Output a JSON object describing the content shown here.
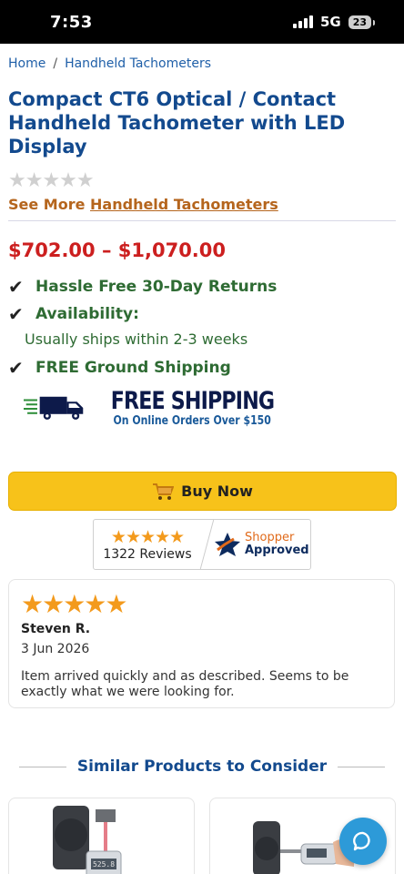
{
  "status_bar": {
    "time": "7:53",
    "network": "5G",
    "battery": "23"
  },
  "breadcrumb": {
    "home": "Home",
    "separator": "/",
    "category": "Handheld Tachometers"
  },
  "product": {
    "title": "Compact CT6 Optical / Contact Handheld Tachometer with LED Display",
    "rating_stars_empty": "★★★★★",
    "see_more_prefix": "See More",
    "see_more_link": "Handheld Tachometers",
    "price": "$702.00 – $1,070.00"
  },
  "features": {
    "check": "✔",
    "returns": "Hassle Free 30-Day Returns",
    "availability_label": "Availability:",
    "availability_value": "Usually ships within 2-3 weeks",
    "shipping": "FREE Ground Shipping"
  },
  "free_shipping_banner": {
    "headline": "FREE SHIPPING",
    "subline": "On Online Orders Over $150"
  },
  "buy_button": {
    "label": "Buy Now",
    "icon": "cart-icon"
  },
  "shopper_badge": {
    "stars": "★★★★★",
    "review_count": "1322 Reviews",
    "brand_line1": "Shopper",
    "brand_line2": "Approved"
  },
  "review": {
    "stars": "★★★★★",
    "reviewer": "Steven R.",
    "date": "3 Jun 2026",
    "text": "Item arrived quickly and as described. Seems to be exactly what we were looking for."
  },
  "similar_section": {
    "heading": "Similar Products to Consider"
  },
  "colors": {
    "title_blue": "#134a8e",
    "price_red": "#cc1f1f",
    "feature_green": "#2e6b33",
    "buy_yellow": "#f7c21a",
    "star_orange": "#f39a1c",
    "chat_blue": "#2d9ad8"
  },
  "icons": [
    "signal-icon",
    "battery-icon",
    "check-icon",
    "truck-icon",
    "cart-icon",
    "shopper-approved-star-icon",
    "chat-icon"
  ]
}
